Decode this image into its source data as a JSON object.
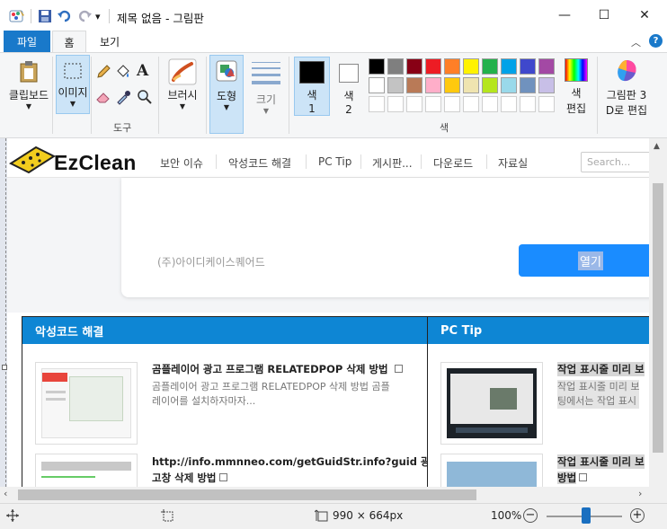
{
  "window": {
    "title": "제목 없음 - 그림판",
    "controls": {
      "minimize": "—",
      "maximize": "☐",
      "close": "✕"
    }
  },
  "quick_access": {
    "dropdown": "▾"
  },
  "tabs": [
    {
      "label": "파일",
      "active": false,
      "primary": true
    },
    {
      "label": "홈",
      "active": true
    },
    {
      "label": "보기",
      "active": false
    }
  ],
  "ribbon": {
    "clipboard": {
      "label": "클립보드"
    },
    "image": {
      "label": "이미지"
    },
    "tools": {
      "label": "도구"
    },
    "brush": {
      "label": "브러시"
    },
    "shapes": {
      "label": "도형"
    },
    "size": {
      "label": "크기"
    },
    "color1": {
      "label": "색",
      "num": "1",
      "color": "#000000"
    },
    "color2": {
      "label": "색",
      "num": "2",
      "color": "#ffffff"
    },
    "colors_group": {
      "label": "색"
    },
    "edit_colors": {
      "line1": "색",
      "line2": "편집"
    },
    "paint3d": {
      "line1": "그림판 3",
      "line2": "D로 편집"
    },
    "palette_row1": [
      "#000000",
      "#7f7f7f",
      "#880015",
      "#ed1c24",
      "#ff7f27",
      "#fff200",
      "#22b14c",
      "#00a2e8",
      "#3f48cc",
      "#a349a4"
    ],
    "palette_row2": [
      "#ffffff",
      "#c3c3c3",
      "#b97a57",
      "#ffaec9",
      "#ffc90e",
      "#efe4b0",
      "#b5e61d",
      "#99d9ea",
      "#7092be",
      "#c8bfe7"
    ]
  },
  "website": {
    "logo": "EzClean",
    "nav": [
      "보안 이슈",
      "악성코드 해결",
      "PC Tip",
      "게시판...",
      "다운로드",
      "자료실"
    ],
    "search_placeholder": "Search...",
    "company": "(주)아이디케이스퀘어드",
    "open_button": "열기",
    "section1": {
      "title": "악성코드 해결",
      "posts": [
        {
          "title": "곰플레이어 광고 프로그램 RELATEDPOP 삭제 방법",
          "desc1": "곰플레이어 광고 프로그램 RELATEDPOP 삭제 방법 곰플",
          "desc2": "레이어를 설치하자마자..."
        },
        {
          "title1": "http://info.mmnneo.com/getGuidStr.info?guid 광",
          "title2": "고창 삭제 방법"
        }
      ]
    },
    "section2": {
      "title": "PC Tip",
      "posts": [
        {
          "title": "작업 표시줄 미리 보",
          "desc1": "작업 표시줄 미리 보",
          "desc2": "팅에서는 작업 표시"
        },
        {
          "title1": "작업 표시줄 미리 보",
          "title2": "방법"
        }
      ]
    }
  },
  "status": {
    "dimensions": "990 × 664px",
    "zoom": "100%",
    "zoom_slider_level_percent": 100
  }
}
